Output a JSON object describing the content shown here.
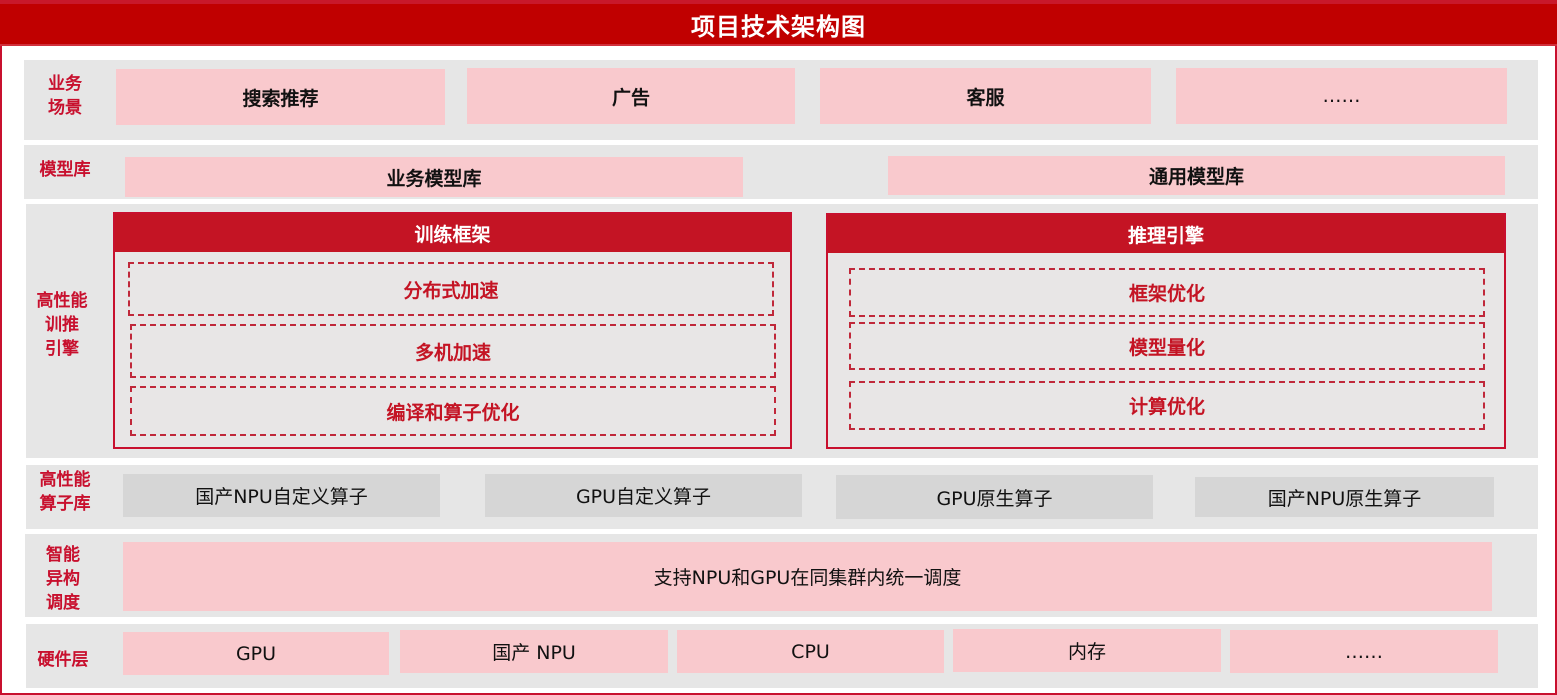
{
  "title": "项目技术架构图",
  "layers": {
    "business": {
      "label_lines": [
        "业务",
        "场景"
      ],
      "items": [
        "搜索推荐",
        "广告",
        "客服",
        "……"
      ]
    },
    "model_library": {
      "label": "模型库",
      "items": [
        "业务模型库",
        "通用模型库"
      ]
    },
    "engine": {
      "label_lines": [
        "高性能",
        "训推",
        "引擎"
      ],
      "training": {
        "title": "训练框架",
        "items": [
          "分布式加速",
          "多机加速",
          "编译和算子优化"
        ]
      },
      "inference": {
        "title": "推理引擎",
        "items": [
          "框架优化",
          "模型量化",
          "计算优化"
        ]
      }
    },
    "operators": {
      "label_lines": [
        "高性能",
        "算子库"
      ],
      "items": [
        "国产NPU自定义算子",
        "GPU自定义算子",
        "GPU原生算子",
        "国产NPU原生算子"
      ]
    },
    "scheduling": {
      "label_lines": [
        "智能",
        "异构",
        "调度"
      ],
      "text": "支持NPU和GPU在同集群内统一调度"
    },
    "hardware": {
      "label": "硬件层",
      "items": [
        "GPU",
        "国产 NPU",
        "CPU",
        "内存",
        "……"
      ]
    }
  },
  "colors": {
    "accent_red": "#c8102e",
    "title_red": "#c00000",
    "pink_box": "#f9c9cd",
    "grey_box": "#d6d6d6",
    "layer_bg": "#e6e6e6"
  }
}
